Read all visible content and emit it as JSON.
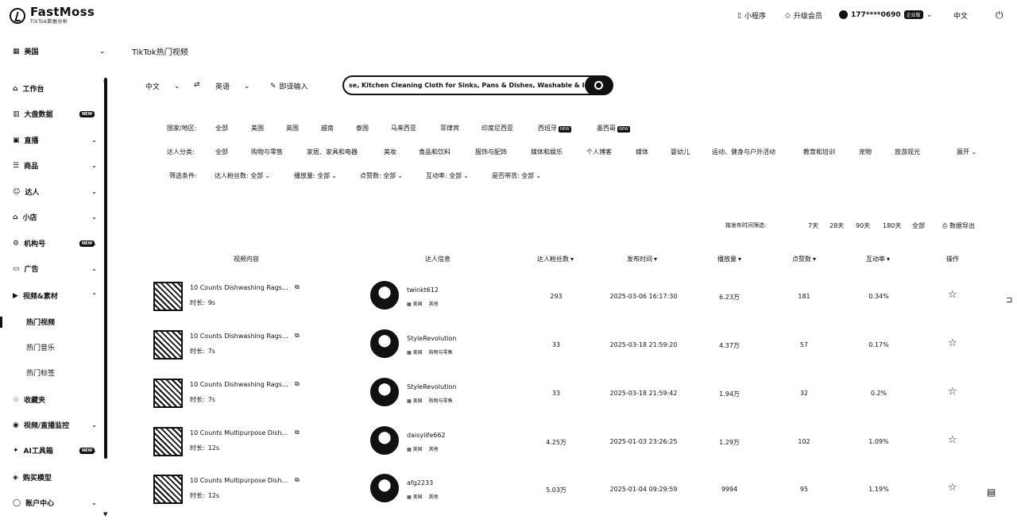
{
  "top": {
    "brand": "FastMoss",
    "brand_sub": "TikTok数据分析",
    "mini_program": "小程序",
    "upgrade": "升级会员",
    "user": "177****0690",
    "vip_badge": "企业版",
    "language": "中文"
  },
  "sidebar": {
    "region": "美国",
    "items": [
      {
        "label": "工作台"
      },
      {
        "label": "大盘数据",
        "badge": "NEW"
      },
      {
        "label": "直播"
      },
      {
        "label": "商品"
      },
      {
        "label": "达人"
      },
      {
        "label": "小店"
      },
      {
        "label": "机构号",
        "badge": "NEW"
      },
      {
        "label": "广告"
      },
      {
        "label": "视频&素材"
      },
      {
        "label": "收藏夹"
      },
      {
        "label": "视频/直播监控"
      },
      {
        "label": "AI工具箱",
        "badge": "NEW"
      },
      {
        "label": "购买模型"
      },
      {
        "label": "账户中心"
      }
    ],
    "sub_items": [
      "热门视频",
      "热门音乐",
      "热门标签"
    ]
  },
  "main": {
    "title": "TikTok热门视频",
    "source_lang": "中文",
    "target_lang": "英语",
    "translate_input": "即译输入",
    "search_value": "se, Kitchen Cleaning Cloth for Sinks, Pans & Dishes, Washable & Durable",
    "filters": {
      "region_label": "国家/地区:",
      "regions": [
        "全部",
        "美国",
        "英国",
        "越南",
        "泰国",
        "马来西亚",
        "菲律宾",
        "印度尼西亚",
        "西班牙",
        "墨西哥"
      ],
      "region_new": [
        "西班牙",
        "墨西哥"
      ],
      "category_label": "达人分类:",
      "categories": [
        "全部",
        "购物与零售",
        "家居、家具和电器",
        "美妆",
        "食品和饮料",
        "服饰与配饰",
        "媒体和娱乐",
        "个人博客",
        "媒体",
        "婴幼儿",
        "运动、健身与户外活动",
        "教育和培训",
        "宠物",
        "旅游观光"
      ],
      "expand": "展开",
      "condition_label": "筛选条件:",
      "conditions": [
        "达人粉丝数: 全部",
        "播放量: 全部",
        "点赞数: 全部",
        "互动率: 全部",
        "是否带货: 全部"
      ]
    },
    "time_filter": {
      "label": "按发布时间筛选:",
      "options": [
        "7天",
        "28天",
        "90天",
        "180天",
        "全部"
      ],
      "export": "数据导出"
    },
    "table": {
      "headers": [
        "视频内容",
        "达人信息",
        "达人粉丝数",
        "发布时间",
        "播放量",
        "点赞数",
        "互动率",
        "操作"
      ],
      "duration_label": "时长:",
      "rows": [
        {
          "title": "10 Counts Dishwashing Rags…",
          "duration": "9s",
          "creator": "twinkt612",
          "region": "美国",
          "category": "其他",
          "fans": "293",
          "time": "2025-03-06 16:17:30",
          "plays": "6.23万",
          "likes": "181",
          "rate": "0.34%"
        },
        {
          "title": "10 Counts Dishwashing Rags…",
          "duration": "7s",
          "creator": "StyleRevolution",
          "region": "美国",
          "category": "购物与零售",
          "fans": "33",
          "time": "2025-03-18 21:59:20",
          "plays": "4.37万",
          "likes": "57",
          "rate": "0.17%"
        },
        {
          "title": "10 Counts Dishwashing Rags…",
          "duration": "7s",
          "creator": "StyleRevolution",
          "region": "美国",
          "category": "购物与零售",
          "fans": "33",
          "time": "2025-03-18 21:59:42",
          "plays": "1.94万",
          "likes": "32",
          "rate": "0.2%"
        },
        {
          "title": "10 Counts Multipurpose Dish…",
          "duration": "12s",
          "creator": "daisylife662",
          "region": "美国",
          "category": "其他",
          "fans": "4.25万",
          "time": "2025-01-03 23:26:25",
          "plays": "1.29万",
          "likes": "102",
          "rate": "1.09%"
        },
        {
          "title": "10 Counts Multipurpose Dish…",
          "duration": "12s",
          "creator": "afg2233",
          "region": "美国",
          "category": "其他",
          "fans": "5.03万",
          "time": "2025-01-04 09:29:59",
          "plays": "9994",
          "likes": "95",
          "rate": "1.19%"
        }
      ]
    }
  }
}
